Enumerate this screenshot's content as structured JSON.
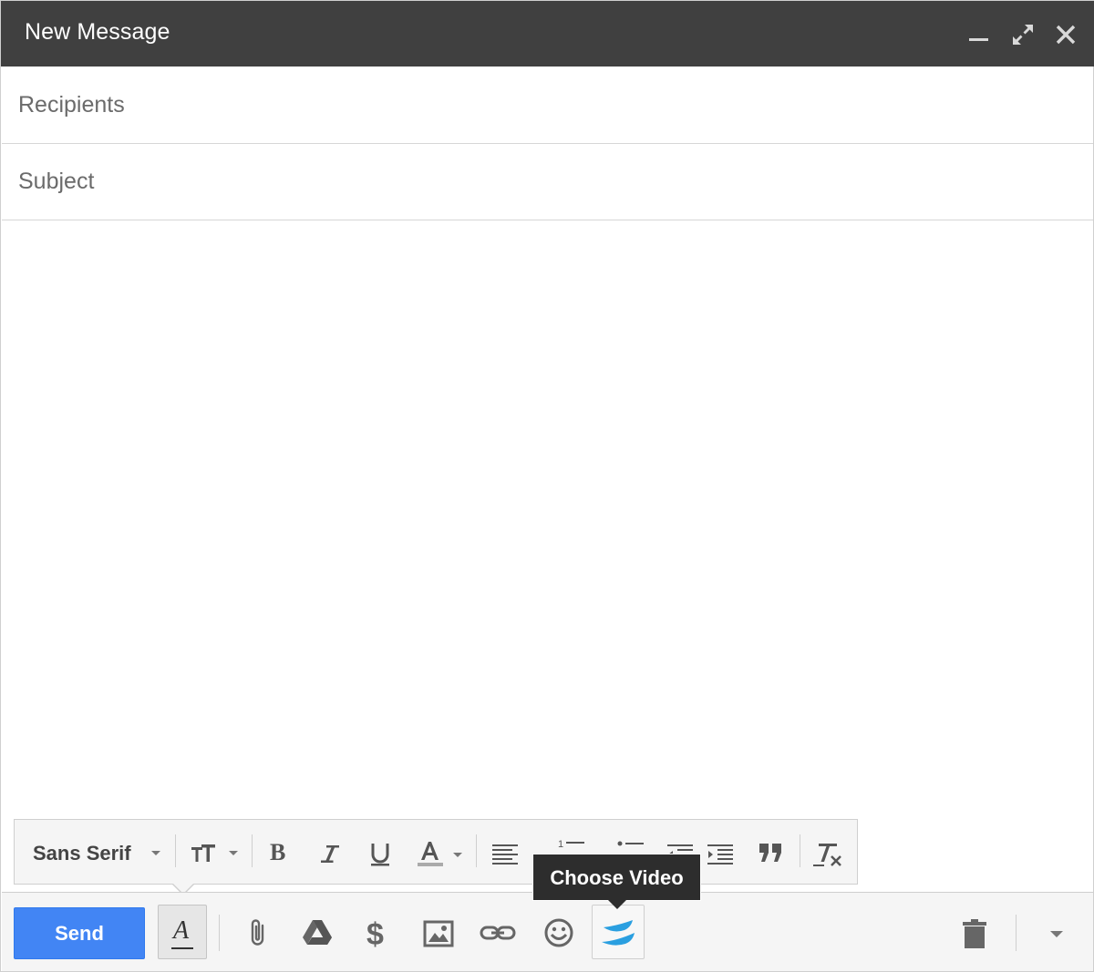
{
  "window": {
    "title": "New Message",
    "minimize_icon": "minimize-icon",
    "popout_icon": "expand-icon",
    "close_icon": "close-icon"
  },
  "fields": {
    "recipients_placeholder": "Recipients",
    "subject_placeholder": "Subject"
  },
  "formatting": {
    "font_family": "Sans Serif",
    "items": [
      "font-size-icon",
      "bold-icon",
      "italic-icon",
      "underline-icon",
      "text-color-icon",
      "align-icon",
      "numbered-list-icon",
      "bulleted-list-icon",
      "indent-less-icon",
      "indent-more-icon",
      "quote-icon",
      "remove-formatting-icon"
    ]
  },
  "actions": {
    "send_label": "Send",
    "icons": [
      "formatting-options-icon",
      "attach-icon",
      "drive-icon",
      "money-icon",
      "photo-icon",
      "link-icon",
      "emoji-icon",
      "video-icon",
      "trash-icon",
      "more-options-icon"
    ]
  },
  "tooltip": {
    "text": "Choose Video"
  },
  "colors": {
    "titlebar": "#404040",
    "send_button": "#4285f4",
    "video_brand": "#2a9fe0",
    "tooltip_bg": "#2d2d2d"
  }
}
